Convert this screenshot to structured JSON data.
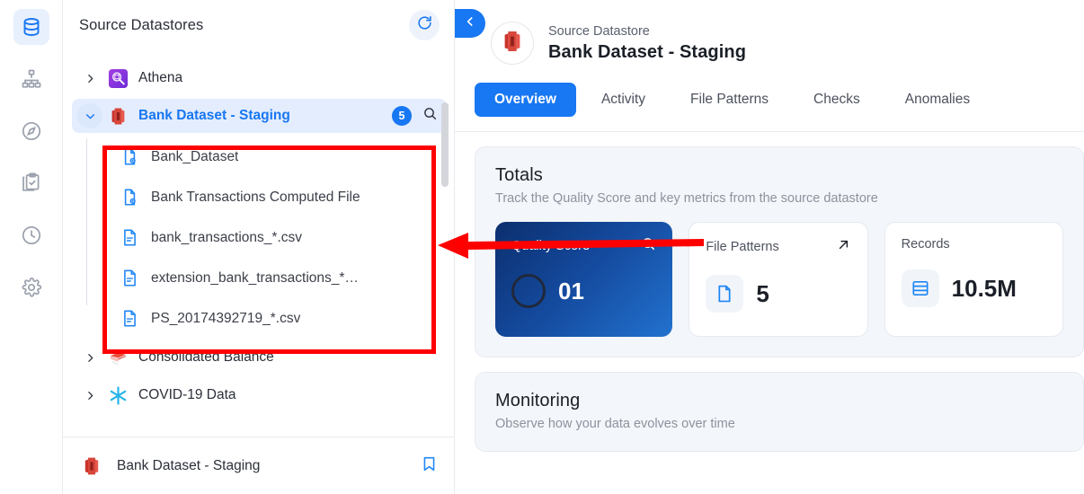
{
  "rail": {
    "items": [
      {
        "name": "datastores",
        "icon": "database-icon",
        "active": true
      },
      {
        "name": "lineage",
        "icon": "sitemap-icon",
        "active": false
      },
      {
        "name": "explore",
        "icon": "compass-icon",
        "active": false
      },
      {
        "name": "checks",
        "icon": "clipboard-check-icon",
        "active": false
      },
      {
        "name": "history",
        "icon": "clock-icon",
        "active": false
      },
      {
        "name": "settings",
        "icon": "gear-icon",
        "active": false
      }
    ]
  },
  "sidebar": {
    "title": "Source Datastores",
    "refresh_icon": "refresh-icon",
    "tree": [
      {
        "label": "Athena",
        "icon": "athena-icon",
        "expanded": false,
        "selected": false,
        "badge": "",
        "children": []
      },
      {
        "label": "Bank Dataset - Staging",
        "icon": "redshift-icon",
        "expanded": true,
        "selected": true,
        "badge": "5",
        "search_icon": "search-icon",
        "children": [
          {
            "label": "Bank_Dataset",
            "icon": "computed-file-icon"
          },
          {
            "label": "Bank Transactions Computed File",
            "icon": "computed-file-icon"
          },
          {
            "label": "bank_transactions_*.csv",
            "icon": "file-icon"
          },
          {
            "label": "extension_bank_transactions_*…",
            "icon": "file-icon"
          },
          {
            "label": "PS_20174392719_*.csv",
            "icon": "file-icon"
          }
        ]
      },
      {
        "label": "Consolidated Balance",
        "icon": "databricks-icon",
        "expanded": false,
        "selected": false,
        "badge": "",
        "children": []
      },
      {
        "label": "COVID-19 Data",
        "icon": "snowflake-icon",
        "expanded": false,
        "selected": false,
        "badge": "",
        "children": []
      }
    ],
    "footer": {
      "label": "Bank Dataset - Staging",
      "icon": "redshift-icon",
      "bookmark_icon": "bookmark-icon"
    }
  },
  "main": {
    "back_icon": "chevron-left-icon",
    "header": {
      "avatar_icon": "redshift-icon",
      "kicker": "Source Datastore",
      "title": "Bank Dataset - Staging"
    },
    "tabs": [
      {
        "label": "Overview",
        "active": true
      },
      {
        "label": "Activity",
        "active": false
      },
      {
        "label": "File Patterns",
        "active": false
      },
      {
        "label": "Checks",
        "active": false
      },
      {
        "label": "Anomalies",
        "active": false
      }
    ],
    "totals": {
      "title": "Totals",
      "subtitle": "Track the Quality Score and key metrics from the source datastore",
      "metrics": [
        {
          "label": "Quality Score",
          "value": "01",
          "head_icon": "search-icon",
          "body_icon": "score-ring-icon",
          "primary": true
        },
        {
          "label": "File Patterns",
          "value": "5",
          "head_icon": "arrow-up-right-icon",
          "body_icon": "file-icon",
          "primary": false
        },
        {
          "label": "Records",
          "value": "10.5M",
          "head_icon": "",
          "body_icon": "records-icon",
          "primary": false
        }
      ]
    },
    "monitoring": {
      "title": "Monitoring",
      "subtitle": "Observe how your data evolves over time"
    }
  },
  "annotation": {
    "highlight_color": "#ff0000",
    "arrow": "left-arrow",
    "box_target": "bank-dataset-staging-file-list"
  }
}
